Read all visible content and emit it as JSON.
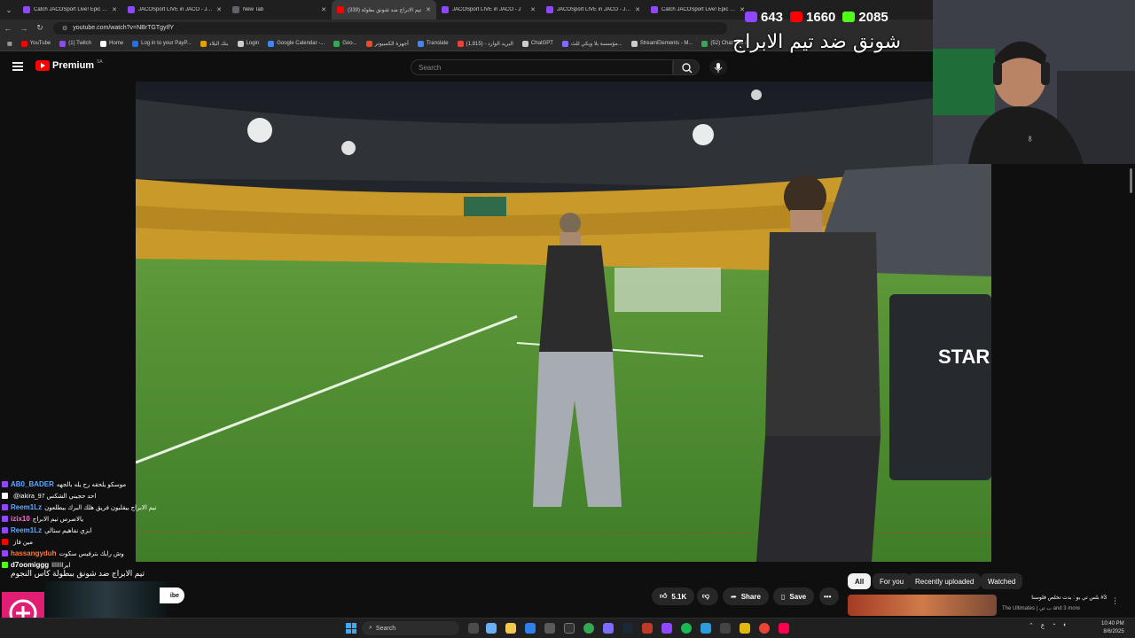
{
  "browser": {
    "tabs": [
      {
        "title": "Catch JACOSport Live! Epic Sp",
        "color": "#9146ff",
        "active": false
      },
      {
        "title": "JACOSport LIVE in JACO - JACO",
        "color": "#9146ff",
        "active": false
      },
      {
        "title": "New Tab",
        "color": "#5f6368",
        "active": false
      },
      {
        "title": "(339) تيم الابراج ضد شونق بطولة",
        "color": "#ff0000",
        "active": true
      },
      {
        "title": "JACOSport LIVE in JACO - J",
        "color": "#9146ff",
        "active": false
      },
      {
        "title": "JACOSport LIVE in JACO - JACO",
        "color": "#9146ff",
        "active": false
      },
      {
        "title": "Catch JACOSport Live! Epic Sp",
        "color": "#9146ff",
        "active": false
      }
    ],
    "url": "youtube.com/watch?v=NBrTGTgyIfY",
    "bookmarks": [
      {
        "label": "YouTube",
        "color": "#ff0000"
      },
      {
        "label": "(1) Twitch",
        "color": "#9146ff"
      },
      {
        "label": "Home",
        "color": "#ffffff"
      },
      {
        "label": "Log in to your PayP...",
        "color": "#1e73e8"
      },
      {
        "label": "بنك البلاد",
        "color": "#e0a000"
      },
      {
        "label": "Login",
        "color": "#cccccc"
      },
      {
        "label": "Google Calendar -...",
        "color": "#4285f4"
      },
      {
        "label": "Goo...",
        "color": "#34a853"
      },
      {
        "label": "أجهزة الكمبيوتر",
        "color": "#e44d26"
      },
      {
        "label": "Translate",
        "color": "#4285f4"
      },
      {
        "label": "(1,815) - البريد الوارد",
        "color": "#ea4335"
      },
      {
        "label": "ChatGPT",
        "color": "#cccccc"
      },
      {
        "label": "مؤسسة بلا ويكي للث...",
        "color": "#7c6cff"
      },
      {
        "label": "StreamElements - M...",
        "color": "#cccccc"
      },
      {
        "label": "(52) Chat Box /",
        "color": "#34a853"
      }
    ]
  },
  "youtube": {
    "brand": "Premium",
    "country": "SA",
    "search_placeholder": "Search",
    "actions": {
      "likes": "5.1K",
      "share": "Share",
      "save": "Save",
      "more": "•••",
      "subscribe_fragment": "ibe"
    },
    "chips": [
      "All",
      "For you",
      "Recently uploaded",
      "Watched"
    ],
    "recommendation": {
      "title": "#3 بلس تي بو : بدت تخلص فلوسنا",
      "channel": "The Ultimates | ب تي",
      "extra": "and 3 more"
    }
  },
  "stream": {
    "overlay_title": "شونق ضد تيم الابراج",
    "stats": [
      {
        "icon": "twitch-icon",
        "value": "643",
        "color": "#9146ff"
      },
      {
        "icon": "youtube-icon",
        "value": "1660",
        "color": "#ff0000"
      },
      {
        "icon": "kick-icon",
        "value": "2085",
        "color": "#53fc18"
      }
    ],
    "chat": [
      {
        "user": "AB0_BADER",
        "user_color": "#5fa8ff",
        "badge": "#9146ff",
        "message": "موسكو يلحقه رح يله بالجهه"
      },
      {
        "user": "",
        "user_color": "#2a4cff",
        "badge": "#ffffff",
        "message": "@iakira_97 احد حجيني الشكس"
      },
      {
        "user": "Reem1Lz",
        "user_color": "#5fa8ff",
        "badge": "#9146ff",
        "message": "تيم الابراج بيقلبون فريق هلك البرك بيطلعون"
      },
      {
        "user": "izix10",
        "user_color": "#ff6ad5",
        "badge": "#9146ff",
        "message": "يالاصرس تيم الابراج"
      },
      {
        "user": "Reem1Lz",
        "user_color": "#5fa8ff",
        "badge": "#9146ff",
        "message": "ابزي نفاهيم ستالي"
      },
      {
        "user": "",
        "user_color": "#2a4cff",
        "badge": "#ff0000",
        "message": "مين فاز"
      },
      {
        "user": "hassangyduh",
        "user_color": "#ff7a3c",
        "badge": "#9146ff",
        "message": "وش رايك بترفيس سكوت"
      },
      {
        "user": "d7oomiggg",
        "user_color": "#ffffff",
        "badge": "#53fc18",
        "message": "ابرااااااا"
      }
    ],
    "bottom_title": "تيم الابراج ضد شونق ببطولة كاس النجوم"
  },
  "video": {
    "board_text": "STAR"
  },
  "taskbar": {
    "search": "Search",
    "time": "10:40 PM",
    "date": "8/6/2025",
    "lang": "ع"
  }
}
